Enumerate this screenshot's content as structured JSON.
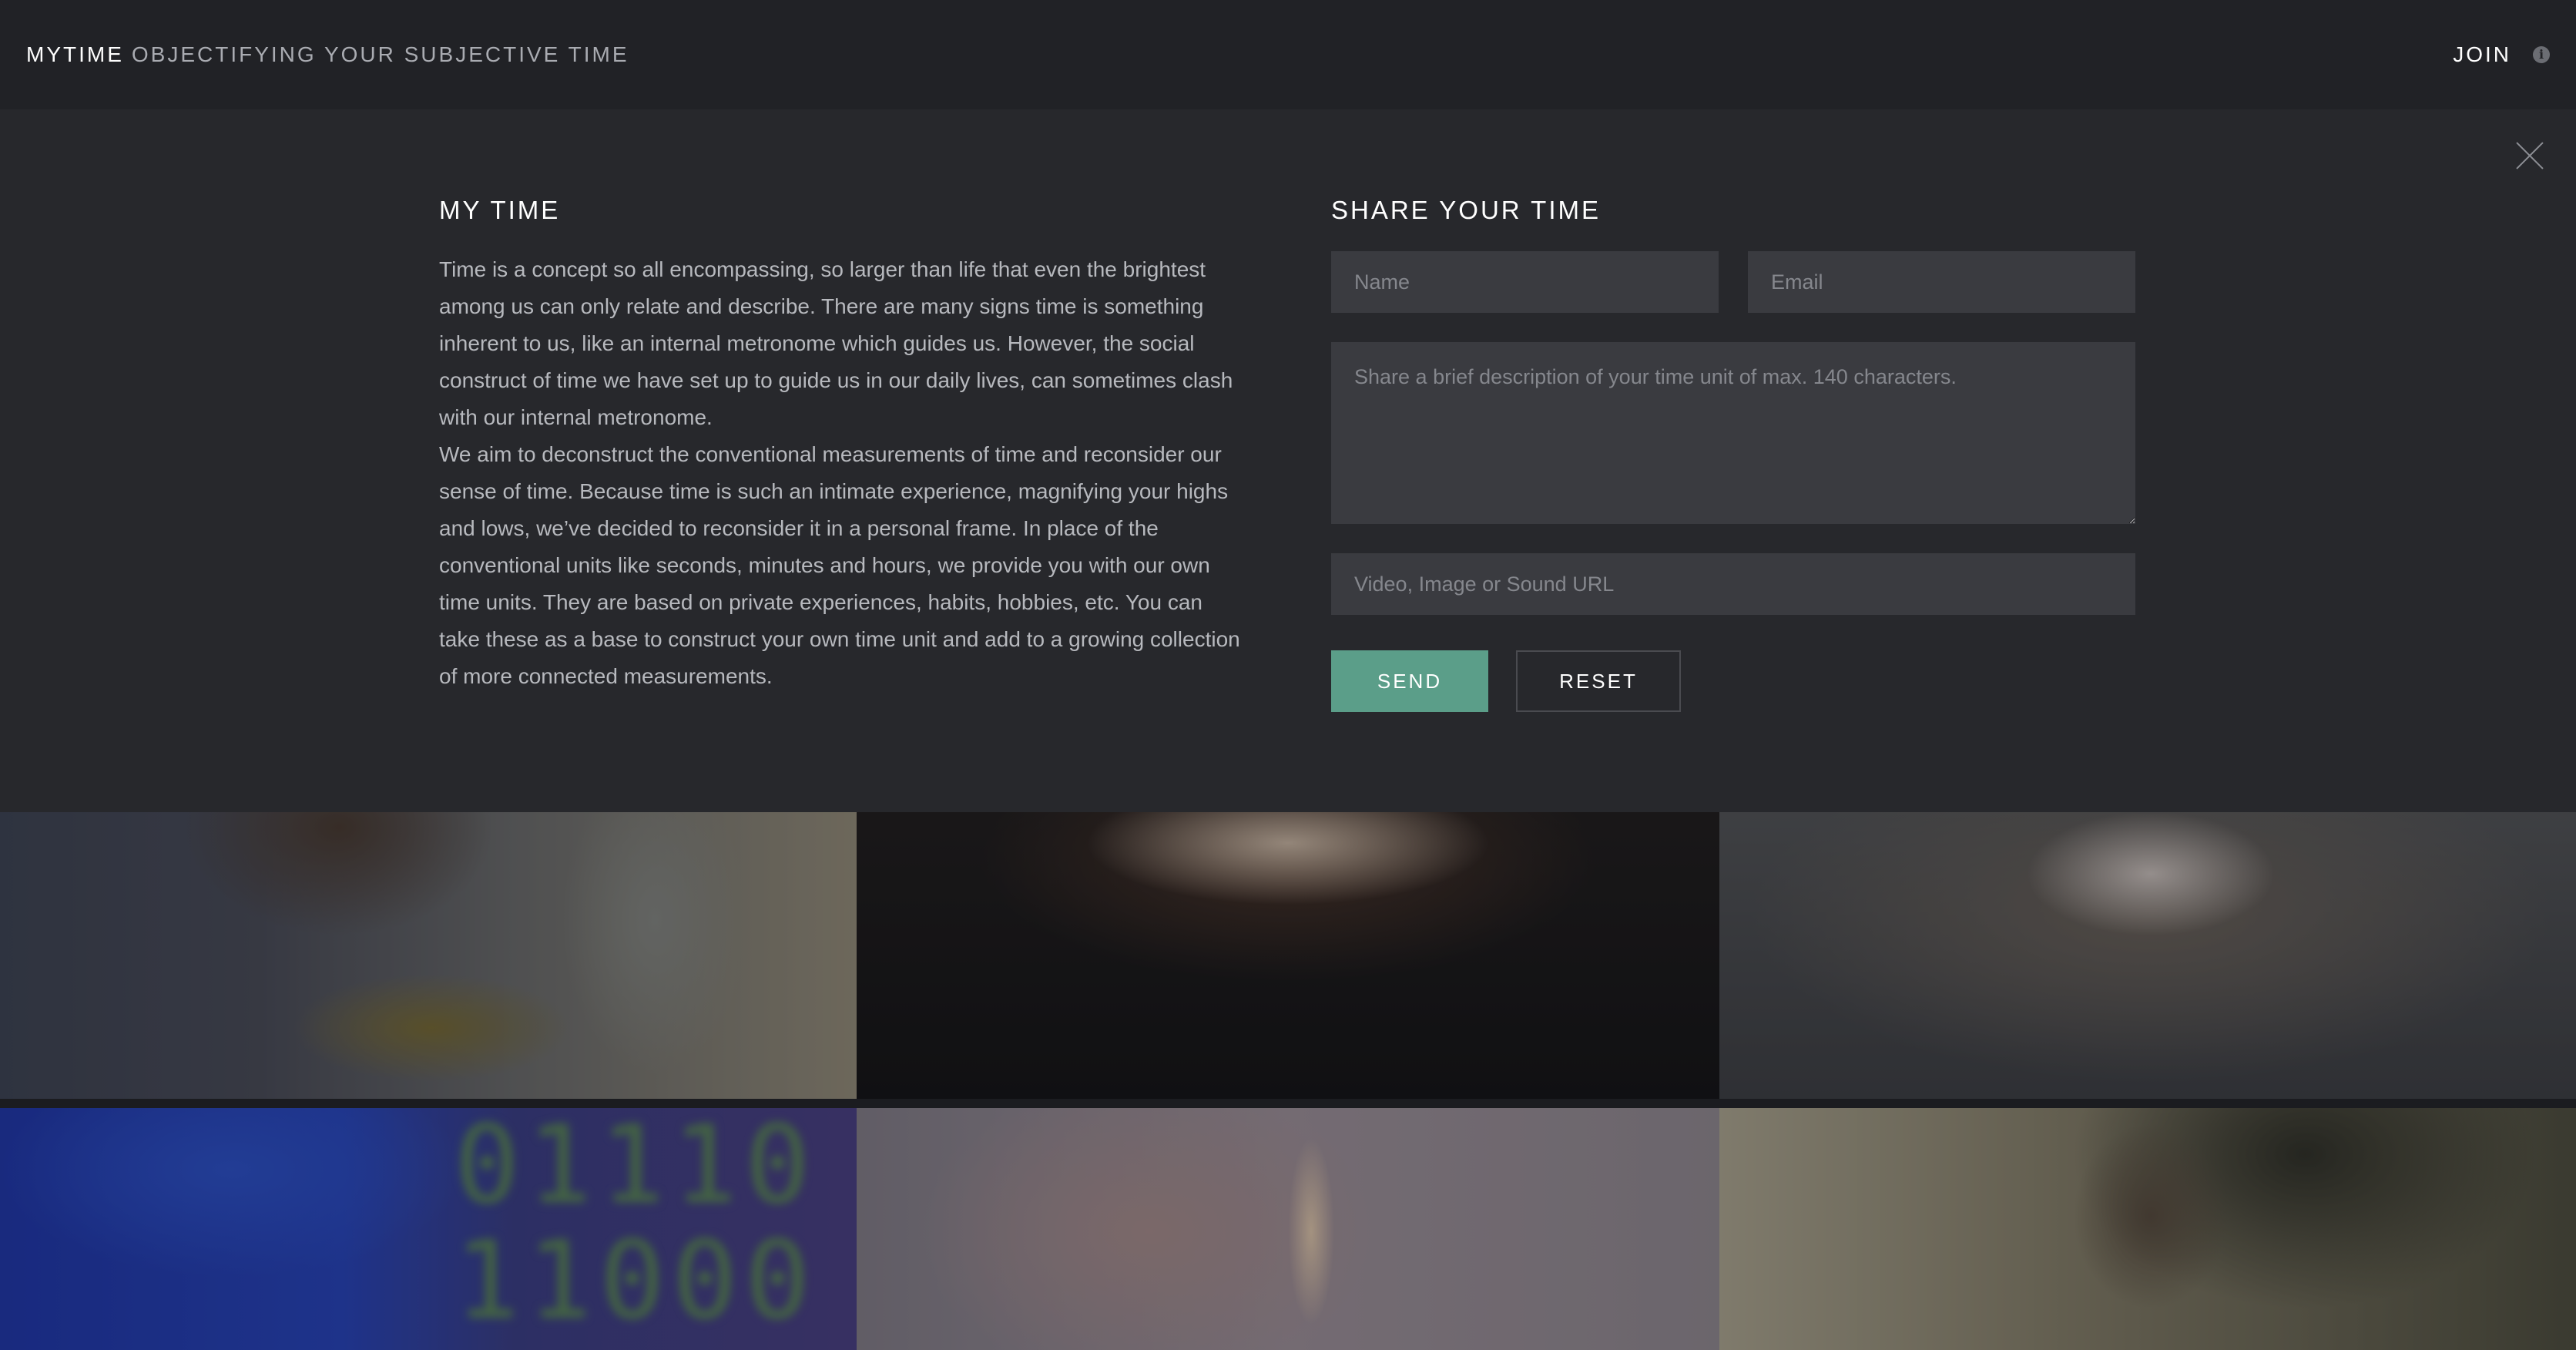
{
  "header": {
    "brand_name": "MYTIME",
    "tagline": "OBJECTIFYING YOUR SUBJECTIVE TIME",
    "join_label": "JOIN",
    "info_icon_glyph": "i"
  },
  "about": {
    "title": "MY TIME",
    "paragraph_1": "Time is a concept so all encompassing, so larger than life that even the brightest among us can only relate and describe. There are many signs time is something inherent to us, like an internal metronome which guides us. However, the social construct of time we have set up to guide us in our daily lives, can sometimes clash with our internal metronome.",
    "paragraph_2": "We aim to deconstruct the conventional measurements of time and reconsider our sense of time. Because time is such an intimate experience, magnifying your highs and lows, we’ve decided to reconsider it in a personal frame. In place of the conventional units like seconds, minutes and hours, we provide you with our own time units. They are based on private experiences, habits, hobbies, etc. You can take these as a base to construct your own time unit and add to a growing collection of more connected measurements."
  },
  "share_form": {
    "title": "SHARE YOUR TIME",
    "name_placeholder": "Name",
    "email_placeholder": "Email",
    "description_placeholder": "Share a brief description of your time unit of max. 140 characters.",
    "url_placeholder": "Video, Image or Sound URL",
    "send_label": "SEND",
    "reset_label": "RESET"
  },
  "grid": {
    "tile_4_digits_line_1": "01110",
    "tile_4_digits_line_2": "11000"
  },
  "colors": {
    "accent_send": "#5b9e89",
    "overlay_bg": "#27282c",
    "topbar_bg": "#212226"
  },
  "icons": [
    "info-icon",
    "close-icon"
  ]
}
